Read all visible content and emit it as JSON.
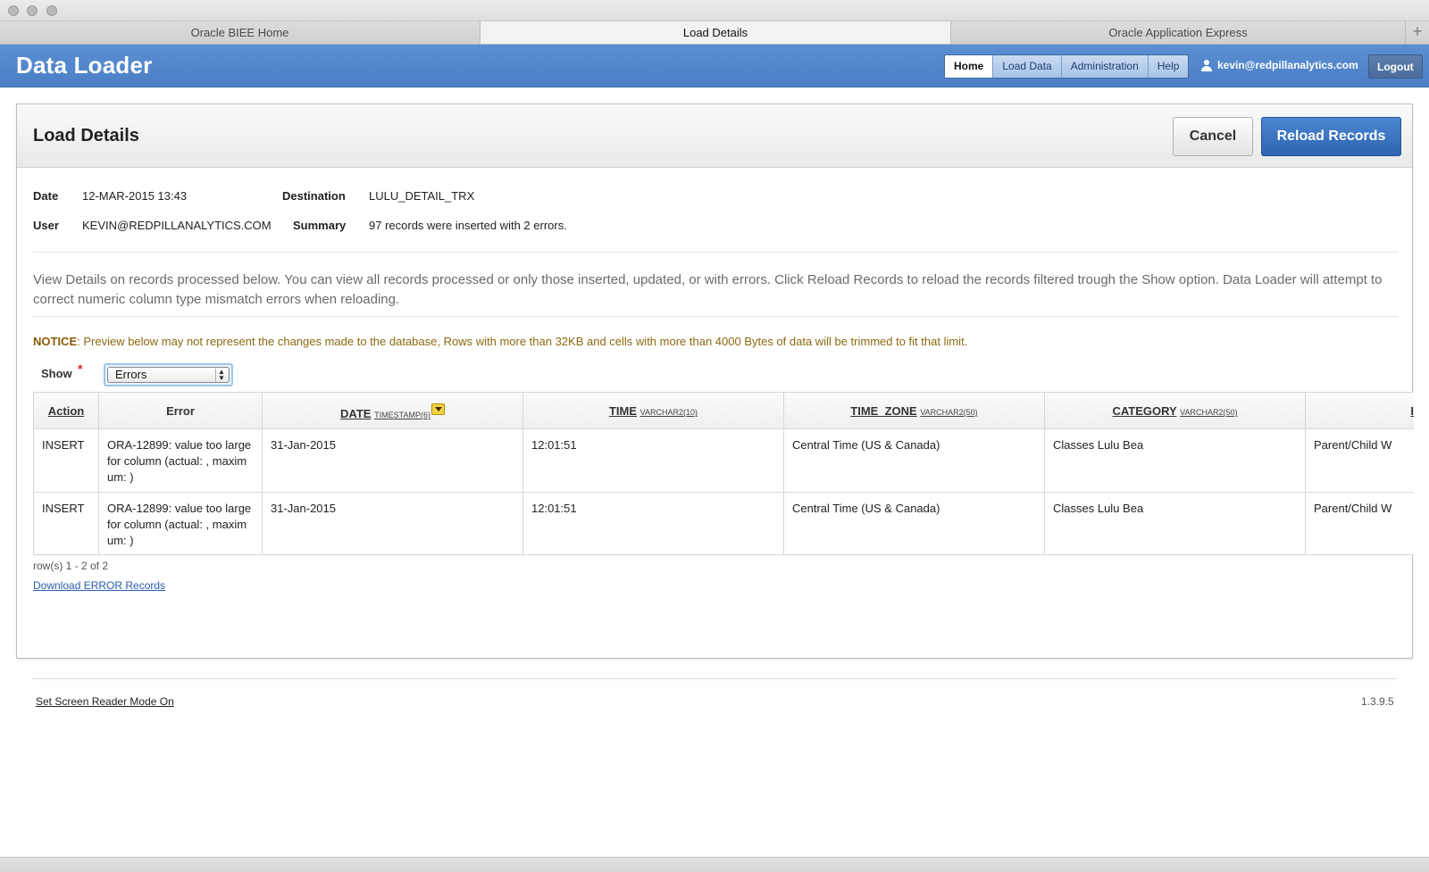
{
  "browser": {
    "tabs": [
      {
        "label": "Oracle BIEE Home"
      },
      {
        "label": "Load Details"
      },
      {
        "label": "Oracle Application Express"
      }
    ],
    "new_tab_glyph": "+"
  },
  "app": {
    "title": "Data Loader",
    "nav": [
      "Home",
      "Load Data",
      "Administration",
      "Help"
    ],
    "active_nav": "Home",
    "user": "kevin@redpillanalytics.com",
    "logout_label": "Logout"
  },
  "panel": {
    "title": "Load Details",
    "cancel_label": "Cancel",
    "reload_label": "Reload Records"
  },
  "details": {
    "date_label": "Date",
    "date_value": "12-MAR-2015 13:43",
    "user_label": "User",
    "user_value": "KEVIN@REDPILLANALYTICS.COM",
    "destination_label": "Destination",
    "destination_value": "LULU_DETAIL_TRX",
    "summary_label": "Summary",
    "summary_value": "97 records were inserted with 2 errors."
  },
  "description": "View Details on records processed below. You can view all records processed or only those inserted, updated, or with errors. Click Reload Records to reload the records filtered trough the Show option. Data Loader will attempt to correct numeric column type mismatch errors when reloading.",
  "notice": {
    "label": "NOTICE",
    "text": ": Preview below may not represent the changes made to the database, Rows with more than 32KB and cells with more than 4000 Bytes of data will be trimmed to fit that limit."
  },
  "filter": {
    "show_label": "Show",
    "required_mark": "*",
    "selected": "Errors"
  },
  "table": {
    "headers": [
      {
        "name": "Action",
        "type": ""
      },
      {
        "name": "Error",
        "type": ""
      },
      {
        "name": "DATE",
        "type": "TIMESTAMP(6)"
      },
      {
        "name": "TIME",
        "type": "VARCHAR2(10)"
      },
      {
        "name": "TIME_ZONE",
        "type": "VARCHAR2(50)"
      },
      {
        "name": "CATEGORY",
        "type": "VARCHAR2(50)"
      },
      {
        "name": "I",
        "type": ""
      }
    ],
    "rows": [
      {
        "action": "INSERT",
        "error": "ORA-12899: value too large for column (actual: , maxim um: )",
        "date": "31-Jan-2015",
        "time": "12:01:51",
        "time_zone": "Central Time (US & Canada)",
        "category": "Classes Lulu Bea",
        "extra": "Parent/Child W"
      },
      {
        "action": "INSERT",
        "error": "ORA-12899: value too large for column (actual: , maxim um: )",
        "date": "31-Jan-2015",
        "time": "12:01:51",
        "time_zone": "Central Time (US & Canada)",
        "category": "Classes Lulu Bea",
        "extra": "Parent/Child W"
      }
    ],
    "row_count": "row(s) 1 - 2 of 2",
    "download_label": "Download ERROR Records"
  },
  "footer": {
    "screen_reader": "Set Screen Reader Mode On",
    "version": "1.3.9.5"
  },
  "colors": {
    "header_blue": "#4a7fc6",
    "primary_button": "#2f64b0",
    "notice": "#8a6a10",
    "link": "#2a5db0"
  }
}
